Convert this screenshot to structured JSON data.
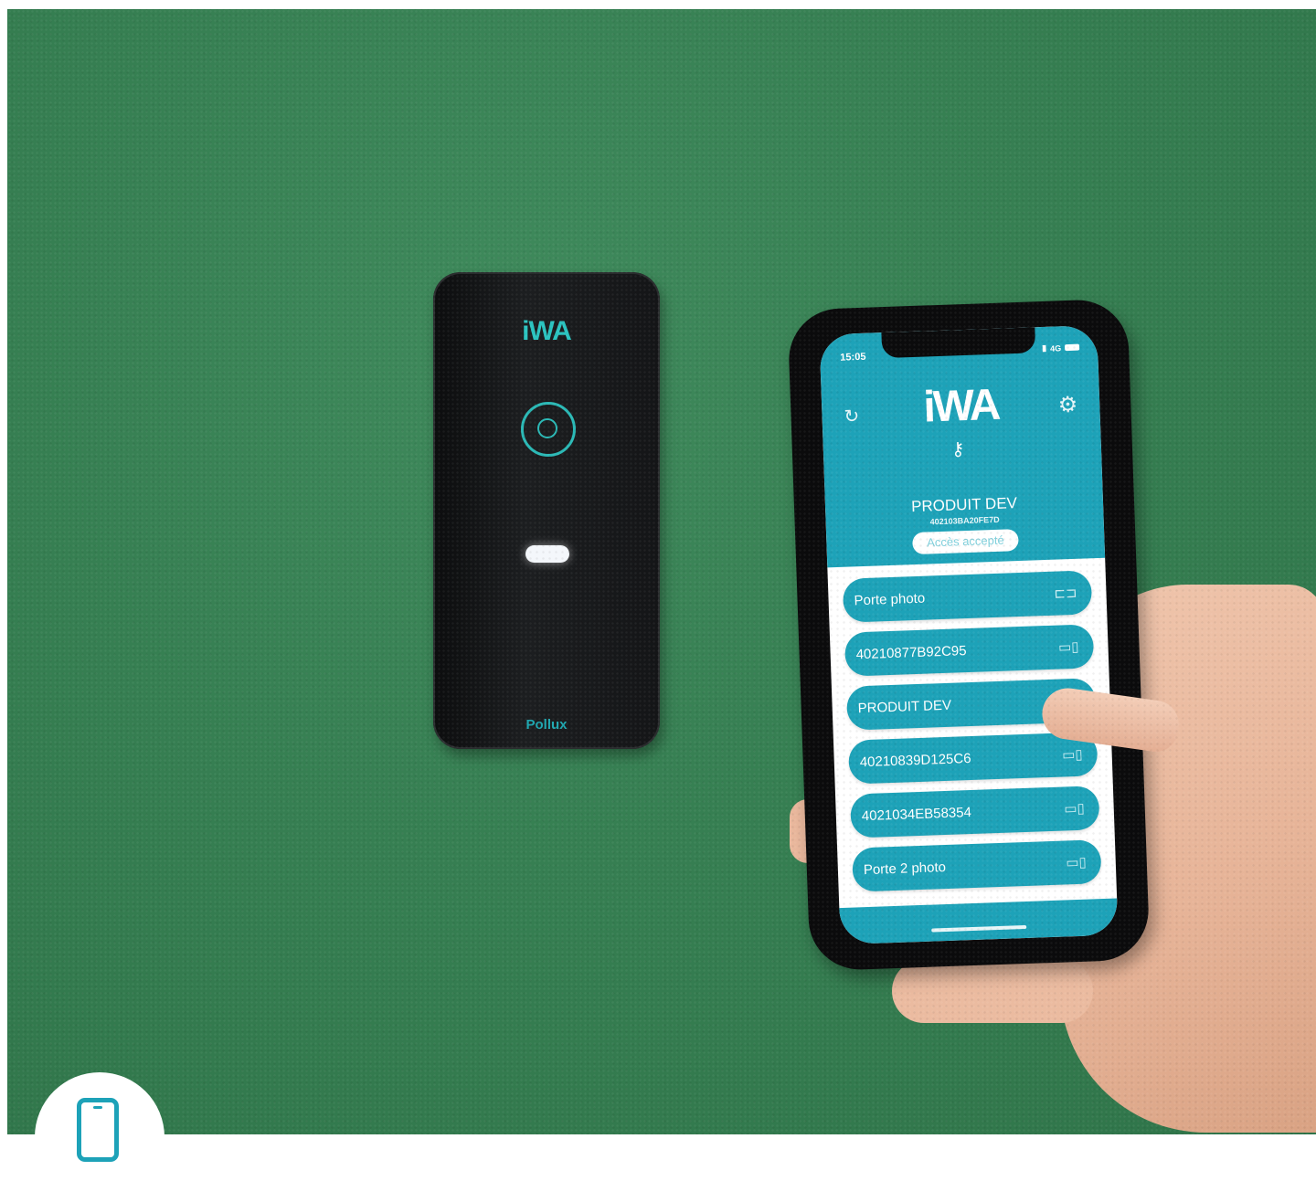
{
  "reader": {
    "logo_text": "iWA",
    "brand_text": "Pollux"
  },
  "phone": {
    "status_time": "15:05",
    "status_network": "4G",
    "app_logo": "iWA",
    "device_name": "PRODUIT DEV",
    "device_id": "402103BA20FE7D",
    "access_status": "Accès accepté",
    "doors": [
      {
        "label": "Porte photo",
        "icon": "door-handle-icon"
      },
      {
        "label": "40210877B92C95",
        "icon": "lock-icon"
      },
      {
        "label": "PRODUIT DEV",
        "icon": "lock-icon"
      },
      {
        "label": "40210839D125C6",
        "icon": "lock-icon"
      },
      {
        "label": "4021034EB58354",
        "icon": "lock-icon"
      },
      {
        "label": "Porte 2 photo",
        "icon": "lock-icon"
      }
    ]
  },
  "colors": {
    "app_accent": "#1da2b8",
    "wall_green": "#367f52",
    "reader_glow": "#2bc4c0"
  }
}
